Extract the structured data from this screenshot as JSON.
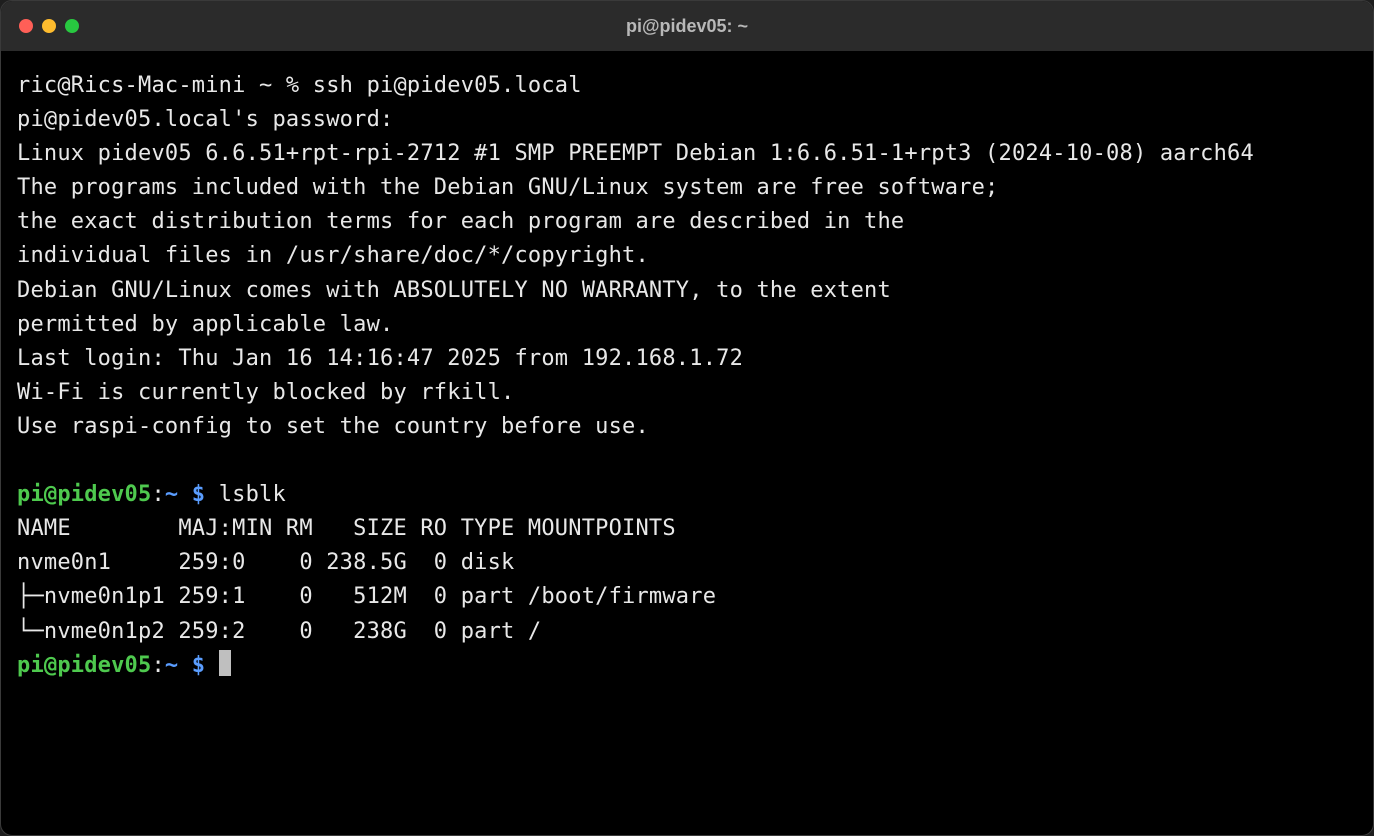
{
  "window": {
    "title": "pi@pidev05: ~"
  },
  "session": {
    "local_prompt": "ric@Rics-Mac-mini ~ % ",
    "ssh_command": "ssh pi@pidev05.local",
    "password_prompt": "pi@pidev05.local's password:",
    "banner": [
      "Linux pidev05 6.6.51+rpt-rpi-2712 #1 SMP PREEMPT Debian 1:6.6.51-1+rpt3 (2024-10-08) aarch64",
      "",
      "The programs included with the Debian GNU/Linux system are free software;",
      "the exact distribution terms for each program are described in the",
      "individual files in /usr/share/doc/*/copyright.",
      "",
      "Debian GNU/Linux comes with ABSOLUTELY NO WARRANTY, to the extent",
      "permitted by applicable law.",
      "Last login: Thu Jan 16 14:16:47 2025 from 192.168.1.72",
      "",
      "Wi-Fi is currently blocked by rfkill.",
      "Use raspi-config to set the country before use."
    ],
    "remote_prompt": {
      "user_host": "pi@pidev05",
      "sep": ":",
      "path": "~ ",
      "symbol": "$ "
    },
    "command1": "lsblk",
    "lsblk": {
      "header": "NAME        MAJ:MIN RM   SIZE RO TYPE MOUNTPOINTS",
      "rows": [
        "nvme0n1     259:0    0 238.5G  0 disk ",
        "├─nvme0n1p1 259:1    0   512M  0 part /boot/firmware",
        "└─nvme0n1p2 259:2    0   238G  0 part /"
      ]
    }
  }
}
